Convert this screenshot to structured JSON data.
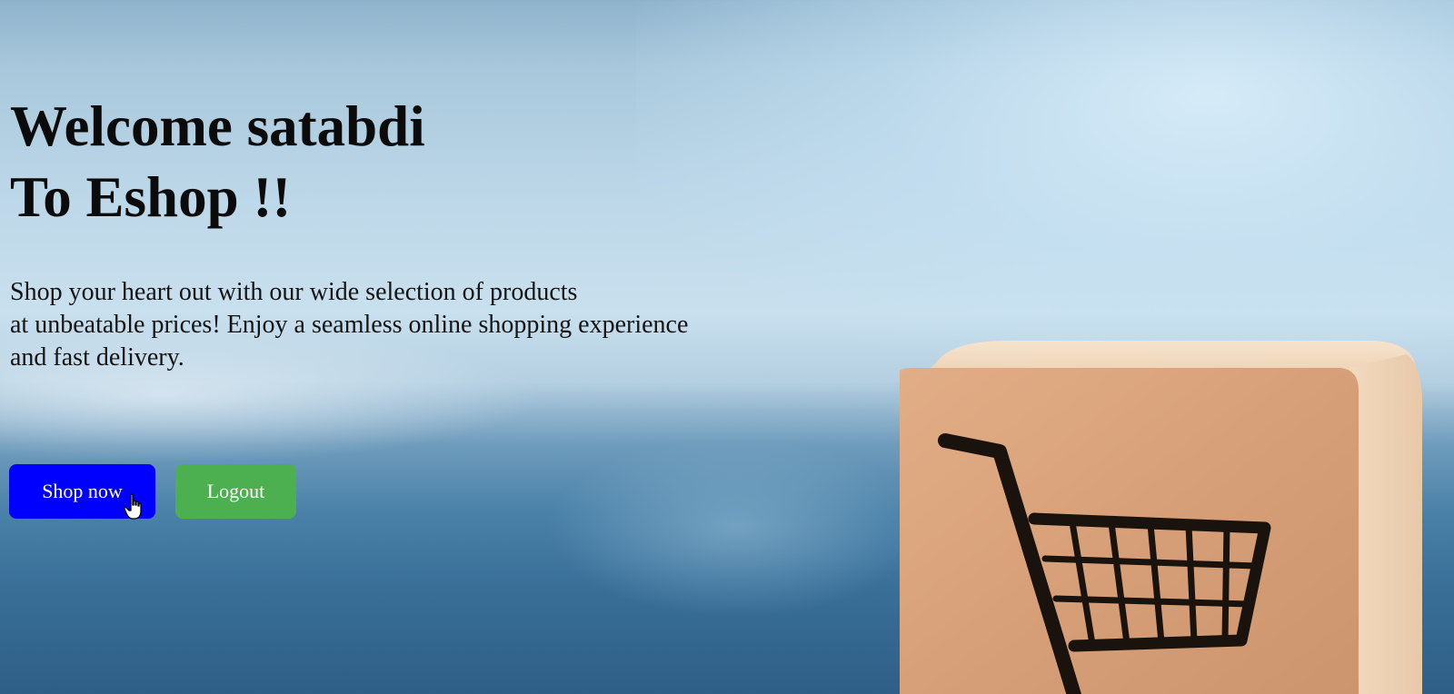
{
  "hero": {
    "title_line1": "Welcome satabdi",
    "title_line2": "To Eshop !!",
    "desc_line1": "Shop your heart out with our wide selection of products",
    "desc_line2": "at unbeatable prices! Enjoy a seamless online shopping experience",
    "desc_line3": "and fast delivery."
  },
  "buttons": {
    "shop_now": "Shop now",
    "logout": "Logout"
  },
  "colors": {
    "shop_button": "#0000ff",
    "logout_button": "#4caf50",
    "block_wood": "#d8a27a"
  },
  "icons": {
    "cursor": "hand-pointer-icon",
    "block": "shopping-cart-icon"
  }
}
